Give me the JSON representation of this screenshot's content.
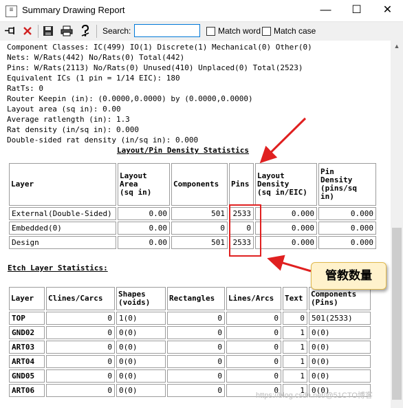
{
  "window": {
    "title": "Summary Drawing Report",
    "icon": "report-icon",
    "controls": {
      "minimize": "—",
      "maximize": "☐",
      "close": "✕"
    }
  },
  "toolbar": {
    "buttons": [
      "pin-icon",
      "close-red-x-icon",
      "save-disk-icon",
      "print-icon",
      "help-icon"
    ],
    "search_label": "Search:",
    "search_value": "",
    "match_word": "Match word",
    "match_case": "Match case"
  },
  "report": {
    "lines": [
      "Component Classes: IC(499) IO(1) Discrete(1) Mechanical(0) Other(0)",
      "Nets: W/Rats(442) No/Rats(0) Total(442)",
      "Pins: W/Rats(2113) No/Rats(0) Unused(410) Unplaced(0) Total(2523)",
      "Equivalent ICs (1 pin = 1/14 EIC): 180",
      "RatTs: 0",
      "Router Keepin (in): (0.0000,0.0000) by (0.0000,0.0000)",
      "Layout area (sq in): 0.00",
      "Average ratlength (in): 1.3",
      "Rat density (in/sq in): 0.000",
      "Double-sided rat density (in/sq in): 0.000"
    ]
  },
  "density_table": {
    "title": "Layout/Pin Density Statistics",
    "headers": [
      "Layer",
      "Layout\nArea\n(sq in)",
      "Components",
      "Pins",
      "Layout\nDensity\n(sq in/EIC)",
      "Pin\nDensity\n(pins/sq\nin)"
    ],
    "rows": [
      [
        "External(Double-Sided)",
        "0.00",
        "501",
        "2533",
        "0.000",
        "0.000"
      ],
      [
        "Embedded(0)",
        "0.00",
        "0",
        "0",
        "0.000",
        "0.000"
      ],
      [
        "Design",
        "0.00",
        "501",
        "2533",
        "0.000",
        "0.000"
      ]
    ]
  },
  "etch_table": {
    "title": "Etch Layer Statistics:",
    "headers": [
      "Layer",
      "Clines/Carcs",
      "Shapes\n(voids)",
      "Rectangles",
      "Lines/Arcs",
      "Text",
      "Components\n(Pins)"
    ],
    "rows": [
      [
        "TOP",
        "0",
        "1(0)",
        "0",
        "0",
        "0",
        "501(2533)"
      ],
      [
        "GND02",
        "0",
        "0(0)",
        "0",
        "0",
        "1",
        "0(0)"
      ],
      [
        "ART03",
        "0",
        "0(0)",
        "0",
        "0",
        "1",
        "0(0)"
      ],
      [
        "ART04",
        "0",
        "0(0)",
        "0",
        "0",
        "1",
        "0(0)"
      ],
      [
        "GND05",
        "0",
        "0(0)",
        "0",
        "0",
        "1",
        "0(0)"
      ],
      [
        "ART06",
        "0",
        "0(0)",
        "0",
        "0",
        "1",
        "0(0)"
      ]
    ]
  },
  "annotation": {
    "callout": "管教数量",
    "color": "#e02020"
  },
  "watermark": "https://blog.csdn.net/@51CTO博客"
}
